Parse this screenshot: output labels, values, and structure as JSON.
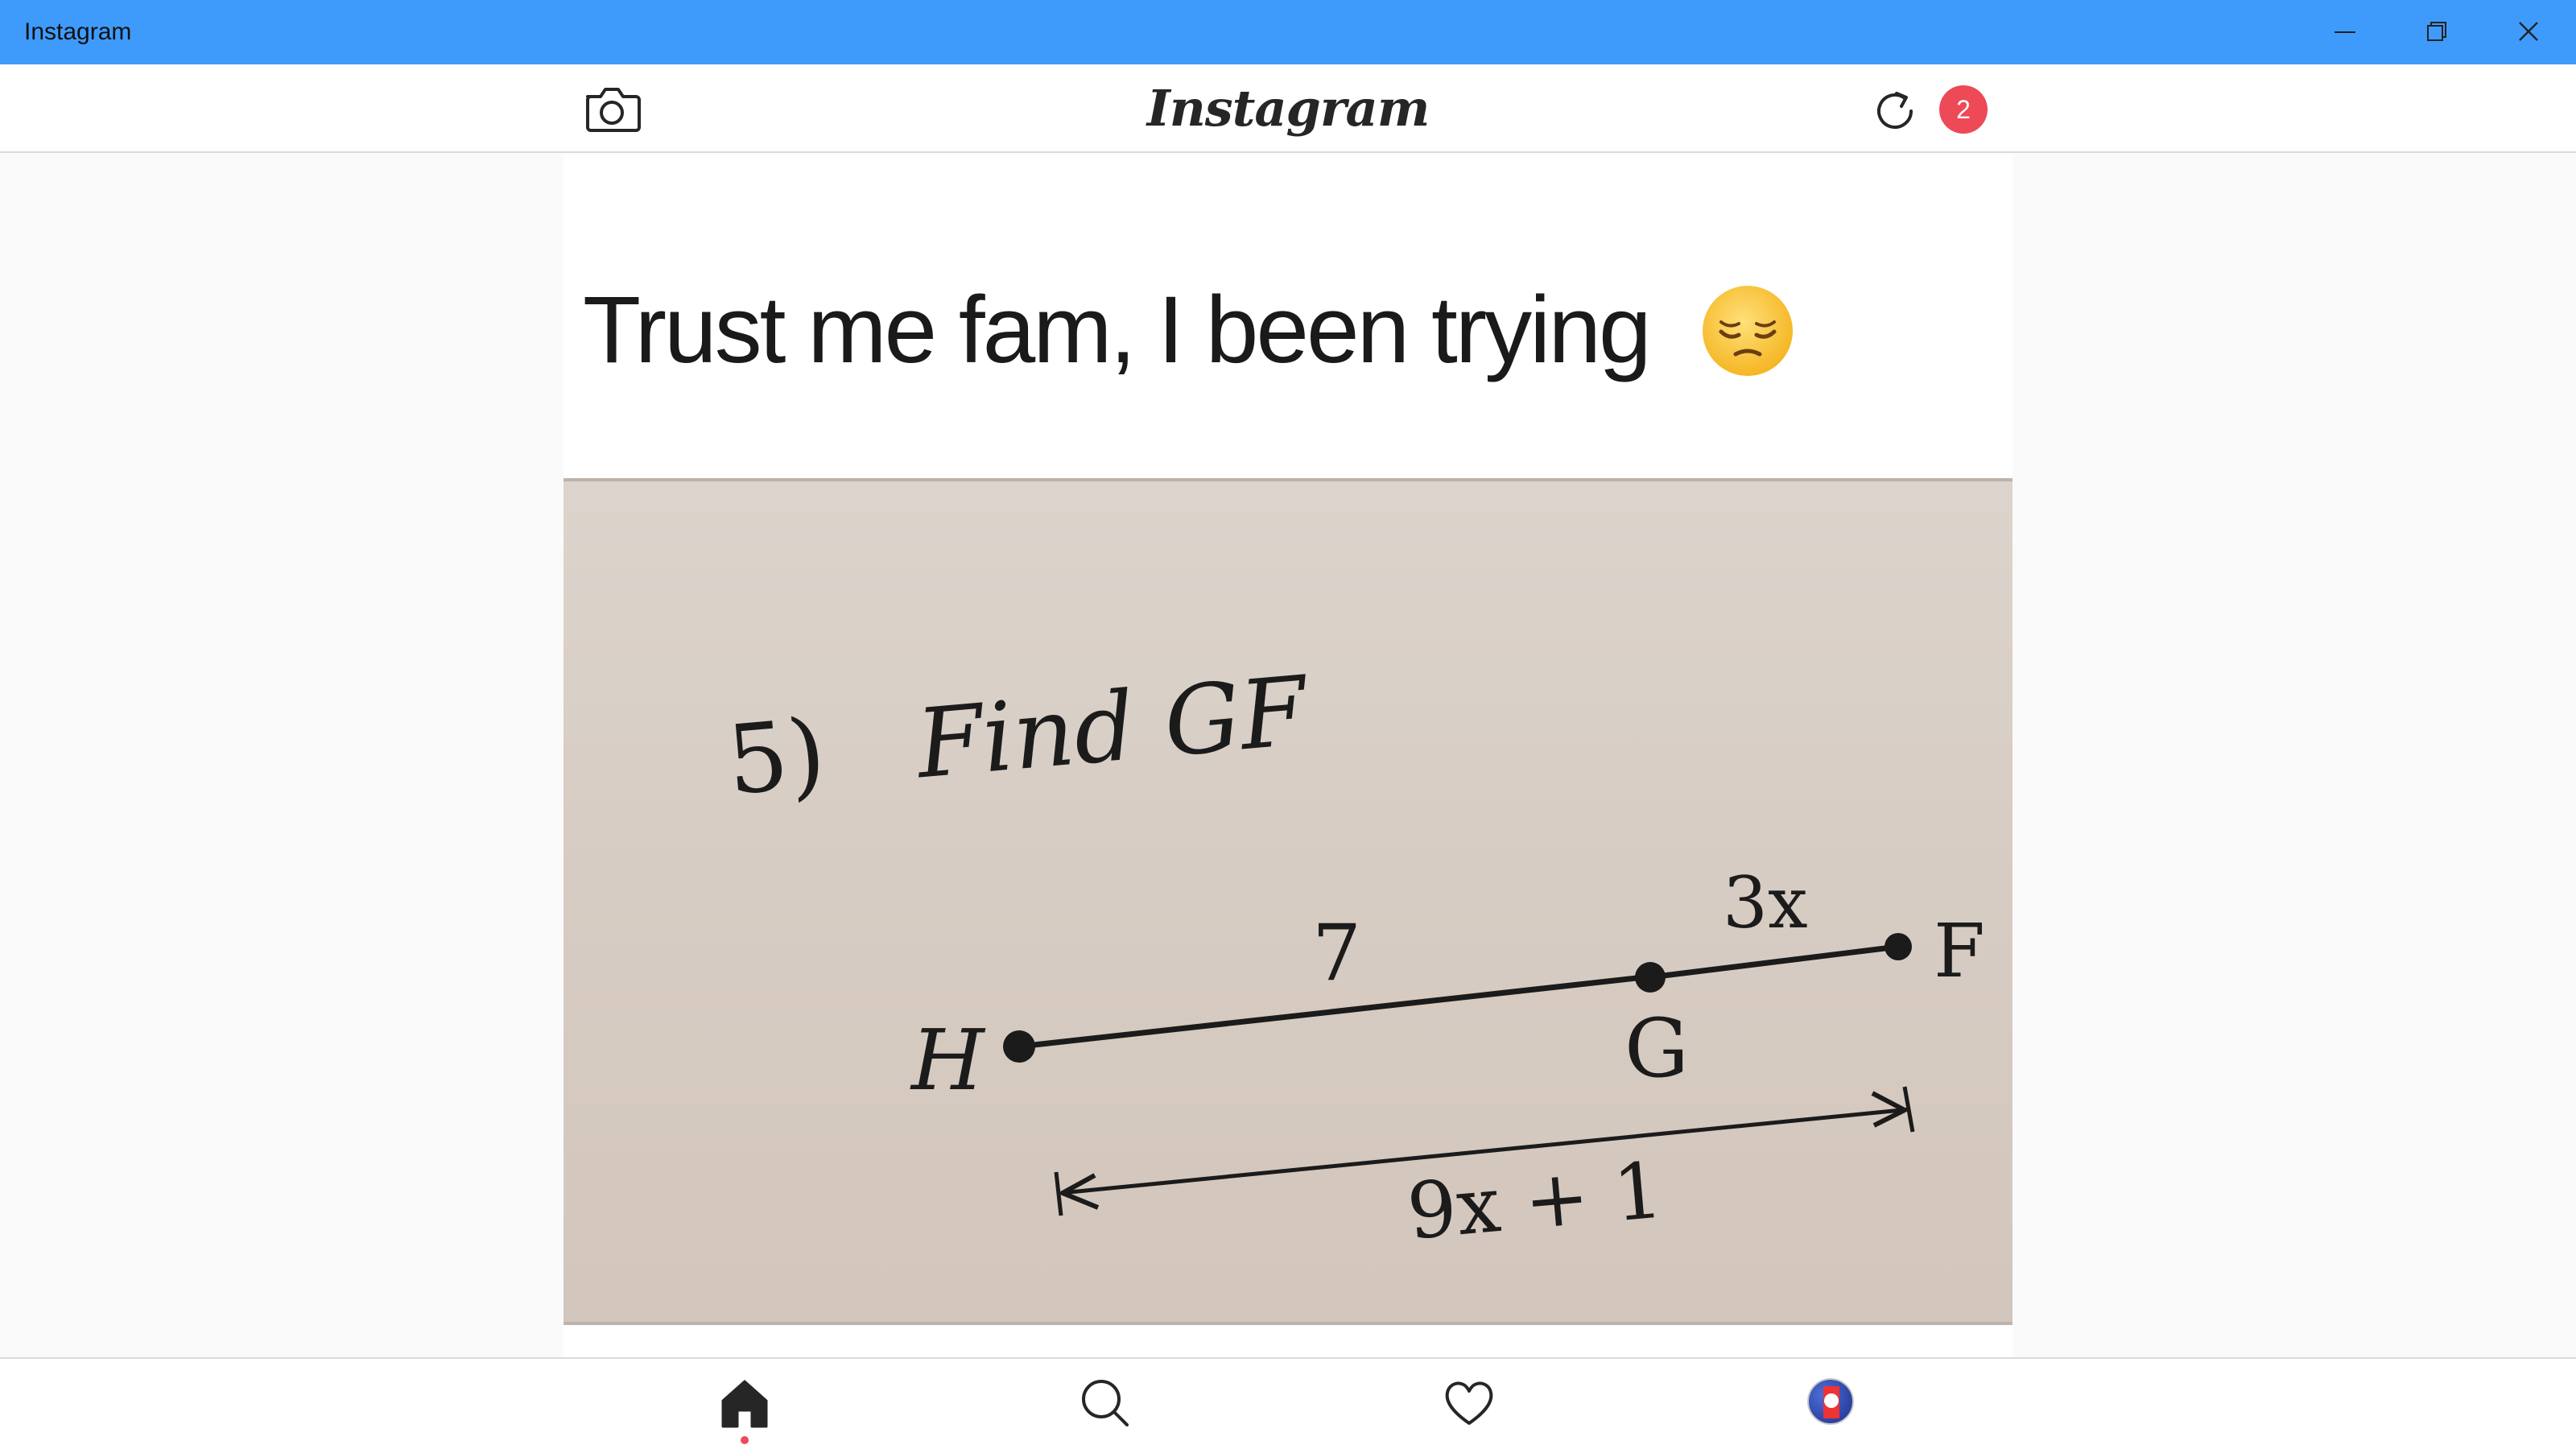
{
  "window": {
    "title": "Instagram",
    "controls": [
      "minimize-icon",
      "restore-icon",
      "close-icon"
    ]
  },
  "header": {
    "logo_text": "Instagram",
    "notification_count": "2",
    "icons": [
      "camera-icon",
      "refresh-icon"
    ]
  },
  "post": {
    "caption": "Trust me fam, I been trying",
    "caption_emoji": "pensive-face-emoji",
    "photo": {
      "question_number": "5)",
      "question_text": "Find GF",
      "label_h": "H",
      "label_g": "G",
      "label_f": "F",
      "segment_hg": "7",
      "segment_gf": "3x",
      "total_length": "9x + 1"
    }
  },
  "bottom_nav": {
    "items": [
      "home-icon",
      "search-icon",
      "heart-icon",
      "profile-avatar"
    ],
    "active": "home"
  },
  "colors": {
    "titlebar": "#3f9bfb",
    "badge": "#ed4956",
    "paper": "#d7cdc4"
  }
}
